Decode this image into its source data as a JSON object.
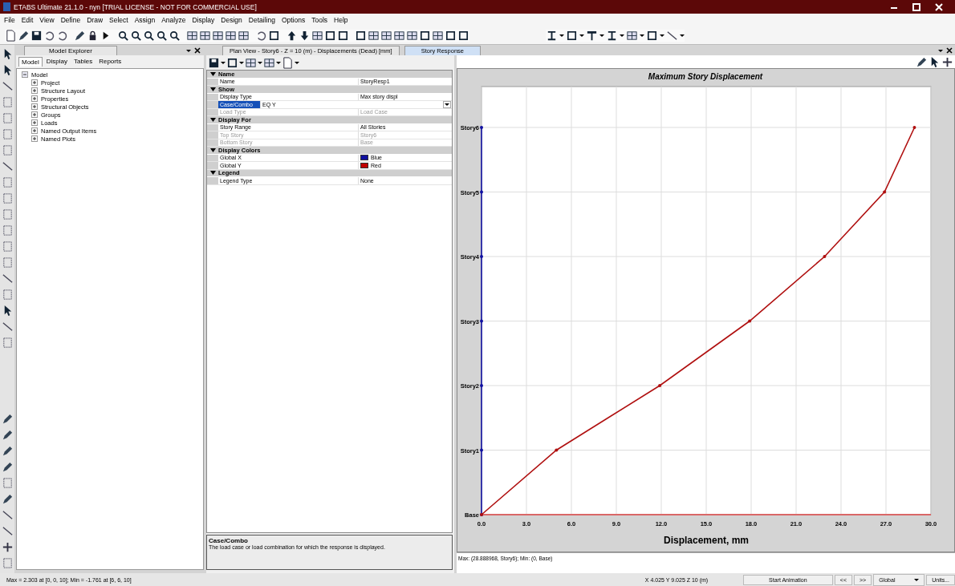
{
  "window": {
    "title": "ETABS Ultimate 21.1.0 - nyn  [TRIAL LICENSE - NOT FOR COMMERCIAL USE]"
  },
  "menu": [
    "File",
    "Edit",
    "View",
    "Define",
    "Draw",
    "Select",
    "Assign",
    "Analyze",
    "Display",
    "Design",
    "Detailing",
    "Options",
    "Tools",
    "Help"
  ],
  "explorer": {
    "title": "Model Explorer",
    "tabs": [
      {
        "label": "Model",
        "selected": true
      },
      {
        "label": "Display",
        "selected": false
      },
      {
        "label": "Tables",
        "selected": false
      },
      {
        "label": "Reports",
        "selected": false
      }
    ],
    "tree": [
      {
        "label": "Model",
        "expanded": true,
        "children": [
          {
            "label": "Project",
            "expanded": false
          },
          {
            "label": "Structure Layout",
            "expanded": false
          },
          {
            "label": "Properties",
            "expanded": false
          },
          {
            "label": "Structural Objects",
            "expanded": false
          },
          {
            "label": "Groups",
            "expanded": false
          },
          {
            "label": "Loads",
            "expanded": false
          },
          {
            "label": "Named Output Items",
            "expanded": false
          },
          {
            "label": "Named Plots",
            "expanded": false
          }
        ]
      }
    ]
  },
  "doc_tabs": [
    {
      "label": "Plan View - Story6 - Z = 10 (m)  - Displacements (Dead)  [mm]",
      "selected": false
    },
    {
      "label": "Story Response",
      "selected": true
    }
  ],
  "property_grid": [
    {
      "title": "Name",
      "expanded": true,
      "rows": [
        {
          "label": "Name",
          "value": "StoryResp1",
          "disabled": false,
          "selected": false
        }
      ]
    },
    {
      "title": "Show",
      "expanded": true,
      "rows": [
        {
          "label": "Display Type",
          "value": "Max story displ",
          "disabled": false,
          "selected": false
        },
        {
          "label": "Case/Combo",
          "value": "EQ Y",
          "disabled": false,
          "selected": true,
          "kind": "dropdown"
        },
        {
          "label": "Load Type",
          "value": "Load Case",
          "disabled": true,
          "selected": false
        }
      ]
    },
    {
      "title": "Display For",
      "expanded": true,
      "rows": [
        {
          "label": "Story Range",
          "value": "All Stories",
          "disabled": false,
          "selected": false
        },
        {
          "label": "Top Story",
          "value": "Story6",
          "disabled": true,
          "selected": false
        },
        {
          "label": "Bottom Story",
          "value": "Base",
          "disabled": true,
          "selected": false
        }
      ]
    },
    {
      "title": "Display Colors",
      "expanded": true,
      "rows": [
        {
          "label": "Global X",
          "value": "Blue",
          "disabled": false,
          "selected": false,
          "kind": "color",
          "color": "#1010a0"
        },
        {
          "label": "Global Y",
          "value": "Red",
          "disabled": false,
          "selected": false,
          "kind": "color",
          "color": "#c00000"
        }
      ]
    },
    {
      "title": "Legend",
      "expanded": true,
      "rows": [
        {
          "label": "Legend Type",
          "value": "None",
          "disabled": false,
          "selected": false
        }
      ]
    }
  ],
  "description": {
    "title": "Case/Combo",
    "text": "The load case or load combination for which the response is displayed."
  },
  "chart": {
    "chart_data": {
      "type": "line",
      "orientation": "horizontal",
      "title": "Maximum Story Displacement",
      "xlabel": "Displacement, mm",
      "grid": true,
      "categories": [
        "Story6",
        "Story5",
        "Story4",
        "Story3",
        "Story2",
        "Story1",
        "Base"
      ],
      "series": [
        {
          "color": "#1010a0",
          "values": [
            0,
            0,
            0,
            0,
            0,
            0,
            0
          ]
        },
        {
          "color": "#b01010",
          "values": [
            28.9,
            26.9,
            22.9,
            17.9,
            11.9,
            5.0,
            0
          ]
        }
      ],
      "xlim": [
        0,
        30
      ],
      "xticks": [
        {
          "value": 0,
          "label": "0.0"
        },
        {
          "value": 3,
          "label": "3.0"
        },
        {
          "value": 6,
          "label": "6.0"
        },
        {
          "value": 9,
          "label": "9.0"
        },
        {
          "value": 12,
          "label": "12.0"
        },
        {
          "value": 15,
          "label": "15.0"
        },
        {
          "value": 18,
          "label": "18.0"
        },
        {
          "value": 21,
          "label": "21.0"
        },
        {
          "value": 24,
          "label": "24.0"
        },
        {
          "value": 27,
          "label": "27.0"
        },
        {
          "value": 30,
          "label": "30.0"
        }
      ]
    },
    "legend": "Max: (28.888968, Story6);  Min: (0, Base)"
  },
  "status_bar": {
    "left": "Max = 2.303 at [0, 0, 10]; Min = -1.761 at [6, 6, 10]",
    "coords": "X 4.025  Y 9.025  Z 10 (m)",
    "animation_button": "Start Animation",
    "prev": "<<",
    "next": ">>",
    "system": "Global",
    "units": "Units..."
  }
}
